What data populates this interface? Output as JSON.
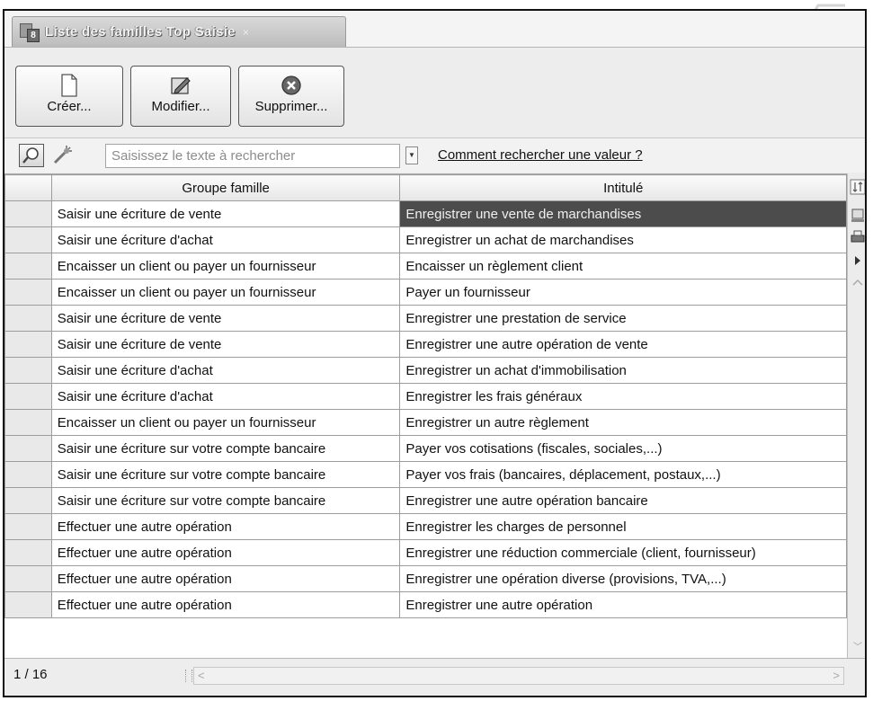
{
  "tab": {
    "title": "Liste des familles Top Saisie",
    "close_icon": "×",
    "icon": "document-list-icon"
  },
  "toolbar": {
    "create_label": "Créer...",
    "modify_label": "Modifier...",
    "delete_label": "Supprimer..."
  },
  "search": {
    "placeholder": "Saisissez le texte à rechercher",
    "help_link": "Comment rechercher une valeur ?"
  },
  "table": {
    "columns": [
      "Groupe famille",
      "Intitulé"
    ],
    "rows": [
      [
        "Saisir une écriture de vente",
        "Enregistrer une vente de marchandises"
      ],
      [
        "Saisir une écriture d'achat",
        "Enregistrer un achat de marchandises"
      ],
      [
        "Encaisser un client ou payer un fournisseur",
        "Encaisser un règlement client"
      ],
      [
        "Encaisser un client ou payer un fournisseur",
        "Payer un fournisseur"
      ],
      [
        "Saisir une écriture de vente",
        "Enregistrer une prestation de service"
      ],
      [
        "Saisir une écriture de vente",
        "Enregistrer une autre opération de vente"
      ],
      [
        "Saisir une écriture d'achat",
        "Enregistrer un achat d'immobilisation"
      ],
      [
        "Saisir une écriture d'achat",
        "Enregistrer les frais généraux"
      ],
      [
        "Encaisser un client ou payer un fournisseur",
        "Enregistrer un autre règlement"
      ],
      [
        "Saisir une écriture sur votre compte bancaire",
        "Payer vos cotisations (fiscales, sociales,...)"
      ],
      [
        "Saisir une écriture sur votre compte bancaire",
        "Payer vos frais (bancaires, déplacement, postaux,...)"
      ],
      [
        "Saisir une écriture sur votre compte bancaire",
        "Enregistrer une autre opération bancaire"
      ],
      [
        "Effectuer une autre opération",
        "Enregistrer les charges de personnel"
      ],
      [
        "Effectuer une autre opération",
        "Enregistrer une réduction commerciale (client, fournisseur)"
      ],
      [
        "Effectuer une autre opération",
        "Enregistrer une opération diverse (provisions, TVA,...)"
      ],
      [
        "Effectuer une autre opération",
        "Enregistrer une autre opération"
      ]
    ],
    "selected_row": 0
  },
  "footer": {
    "record_count": "1 / 16"
  },
  "colors": {
    "selection": "#4c4c4c",
    "header": "#e6e6e6",
    "border": "#111111"
  }
}
